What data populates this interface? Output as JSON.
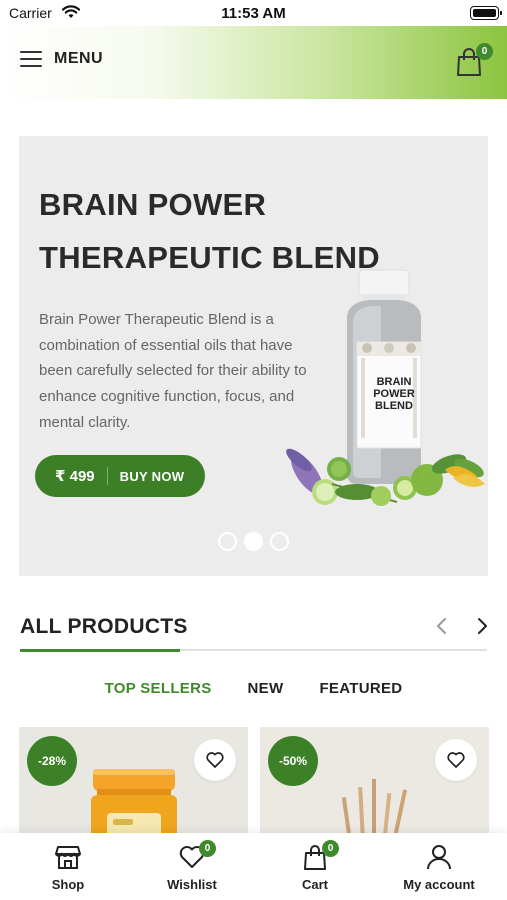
{
  "status_bar": {
    "carrier": "Carrier",
    "time": "11:53 AM"
  },
  "header": {
    "menu_label": "MENU",
    "cart_count": "0"
  },
  "hero": {
    "title": "BRAIN POWER THERAPEUTIC BLEND",
    "description": "Brain Power Therapeutic Blend is a combination of essential oils that have been carefully selected for their ability to enhance cognitive function, focus, and mental clarity.",
    "price": "₹ 499",
    "cta_label": "BUY NOW",
    "bottle_label": "BRAIN POWER BLEND",
    "slides_total": 3,
    "active_slide": 2
  },
  "products_section": {
    "title": "ALL PRODUCTS",
    "tabs": [
      {
        "label": "TOP SELLERS",
        "active": true
      },
      {
        "label": "NEW",
        "active": false
      },
      {
        "label": "FEATURED",
        "active": false
      }
    ],
    "products": [
      {
        "discount": "-28%",
        "image": "honey-jar"
      },
      {
        "discount": "-50%",
        "image": "reed-diffuser"
      }
    ]
  },
  "tabbar": {
    "items": [
      {
        "label": "Shop",
        "icon": "shop-icon"
      },
      {
        "label": "Wishlist",
        "icon": "heart-icon",
        "badge": "0"
      },
      {
        "label": "Cart",
        "icon": "bag-icon",
        "badge": "0"
      },
      {
        "label": "My account",
        "icon": "user-icon"
      }
    ]
  },
  "colors": {
    "brand_green": "#3f8a2c",
    "header_gradient_end": "#8cc43f",
    "hero_bg": "#ececec"
  }
}
